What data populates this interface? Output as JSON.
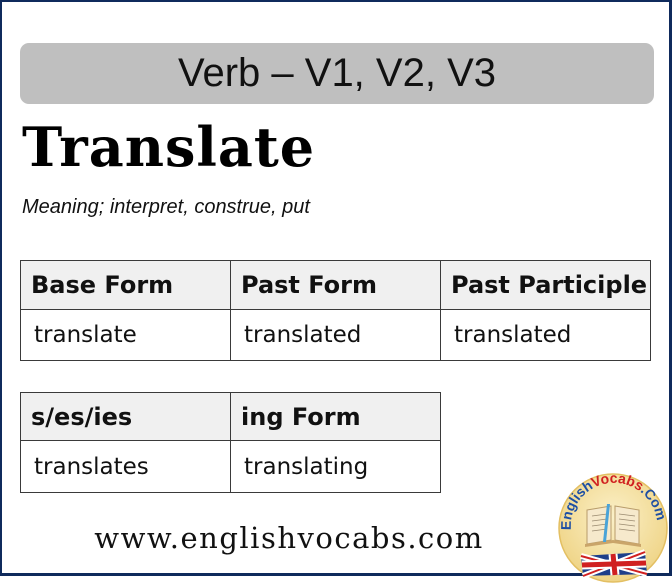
{
  "banner": {
    "title": "Verb – V1, V2, V3"
  },
  "word": {
    "title": "Translate",
    "meaning": "Meaning; interpret, construe, put"
  },
  "table_main": {
    "headers": [
      "Base Form",
      "Past Form",
      "Past Participle"
    ],
    "values": [
      "translate",
      "translated",
      "translated"
    ]
  },
  "table_extra": {
    "headers": [
      "s/es/ies",
      "ing Form"
    ],
    "values": [
      "translates",
      "translating"
    ]
  },
  "footer": {
    "website": "www.englishvocabs.com"
  },
  "logo": {
    "text": "EnglishVocabs.Com",
    "part1": "English",
    "part2": "Vocabs",
    "part3": ".Com"
  },
  "colors": {
    "frame": "#0f2a5c",
    "banner": "#bfbfbf",
    "header_row": "#f0f0f0",
    "logo_blue": "#1e4fa3",
    "logo_red": "#d02020"
  }
}
